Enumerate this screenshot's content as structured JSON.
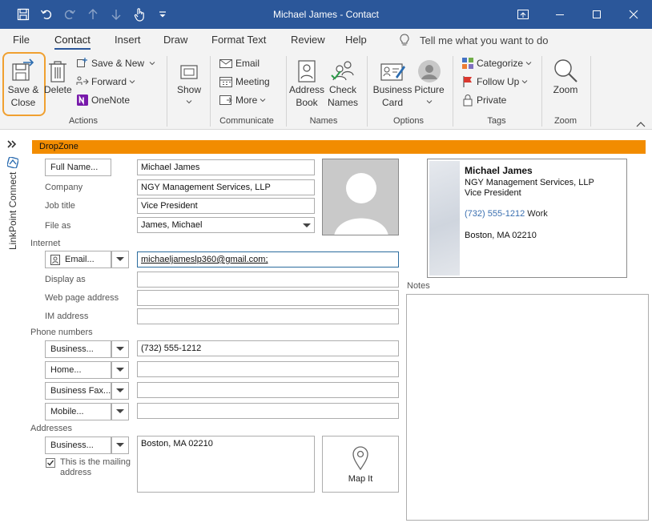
{
  "window": {
    "title": "Michael James  -  Contact"
  },
  "menu_tabs": [
    "File",
    "Contact",
    "Insert",
    "Draw",
    "Format Text",
    "Review",
    "Help"
  ],
  "tell_me": "Tell me what you want to do",
  "ribbon": {
    "actions": {
      "save_close": "Save &\nClose",
      "delete": "Delete",
      "save_new": "Save & New",
      "forward": "Forward",
      "onenote": "OneNote",
      "group": "Actions"
    },
    "show": {
      "label": "Show"
    },
    "communicate": {
      "email": "Email",
      "meeting": "Meeting",
      "more": "More",
      "group": "Communicate"
    },
    "names": {
      "address_book": "Address\nBook",
      "check_names": "Check\nNames",
      "group": "Names"
    },
    "options": {
      "business_card": "Business\nCard",
      "picture": "Picture",
      "group": "Options"
    },
    "tags": {
      "categorize": "Categorize",
      "follow_up": "Follow Up",
      "private": "Private",
      "group": "Tags"
    },
    "zoom": {
      "zoom": "Zoom",
      "group": "Zoom"
    }
  },
  "side_panel": {
    "label": "LinkPoint Connect"
  },
  "dropzone": "DropZone",
  "form": {
    "full_name_button": "Full Name...",
    "full_name": "Michael James",
    "company_label": "Company",
    "company": "NGY Management Services, LLP",
    "job_title_label": "Job title",
    "job_title": "Vice President",
    "file_as_label": "File as",
    "file_as": "James, Michael",
    "internet_section": "Internet",
    "email_button": "Email...",
    "email": "michaeljameslp360@gmail.com;",
    "display_as_label": "Display as",
    "web_page_label": "Web page address",
    "im_label": "IM address",
    "phone_section": "Phone numbers",
    "phone_business_button": "Business...",
    "phone_business": "(732) 555-1212",
    "phone_home_button": "Home...",
    "phone_fax_button": "Business Fax...",
    "phone_mobile_button": "Mobile...",
    "addresses_section": "Addresses",
    "address_button": "Business...",
    "address": "Boston, MA  02210",
    "mailing_checkbox_label": "This is the mailing address",
    "mailing_checked": true,
    "map_it": "Map It",
    "notes_label": "Notes"
  },
  "business_card": {
    "name": "Michael James",
    "company": "NGY Management Services, LLP",
    "title": "Vice President",
    "phone": "(732) 555-1212",
    "phone_type": "Work",
    "address": "Boston, MA  02210"
  },
  "colors": {
    "title_bar": "#2b579a",
    "dropzone": "#f28c00",
    "highlight": "#f0a030"
  }
}
